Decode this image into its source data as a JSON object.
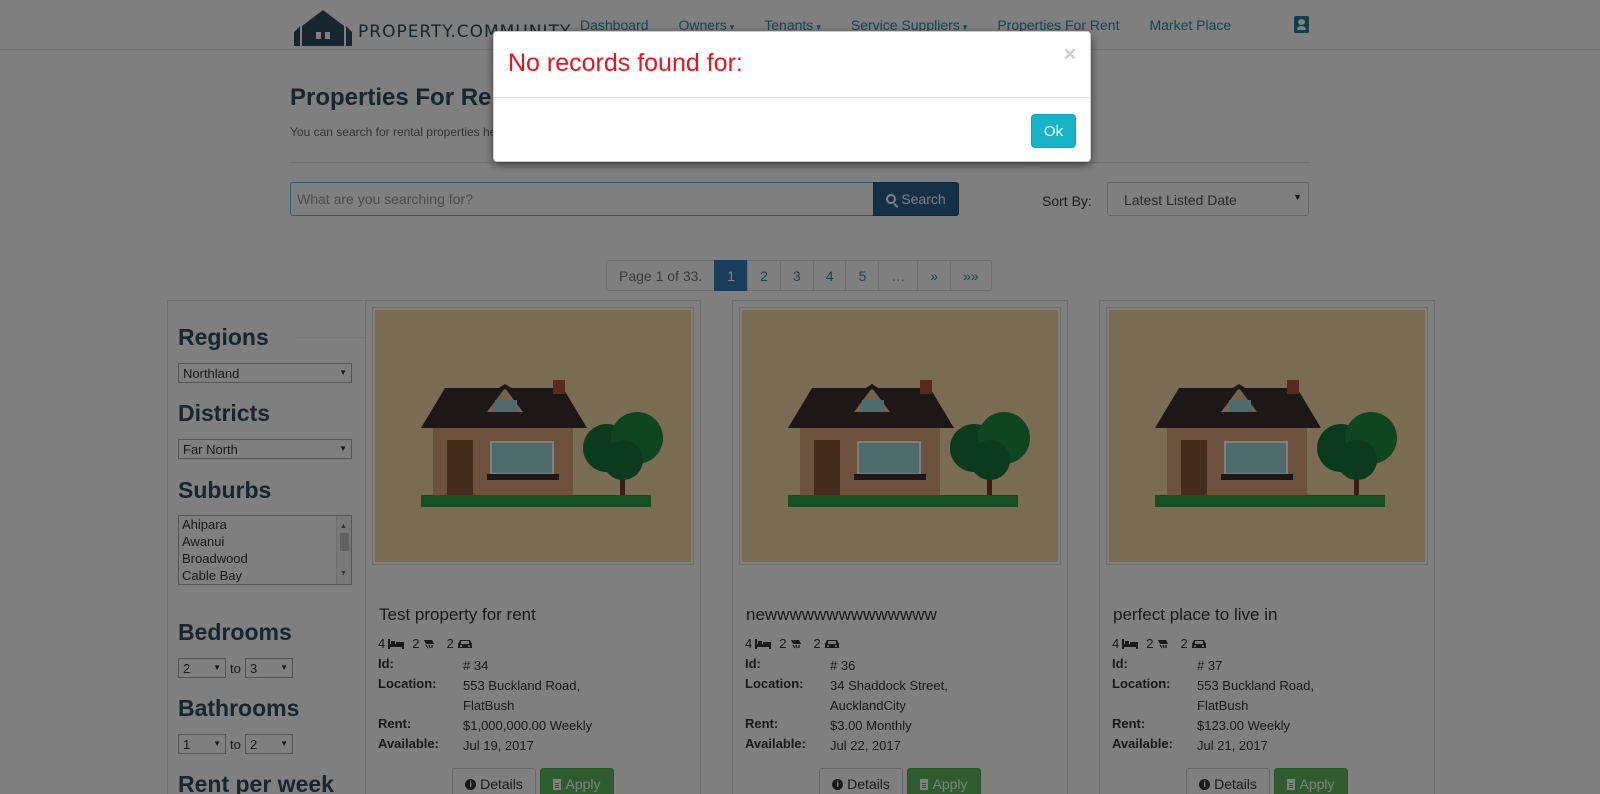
{
  "brand": {
    "logo_text": "PROPERTY.COMMUNITY"
  },
  "nav": {
    "items": [
      {
        "label": "Dashboard",
        "dropdown": false
      },
      {
        "label": "Owners",
        "dropdown": true
      },
      {
        "label": "Tenants",
        "dropdown": true
      },
      {
        "label": "Service Suppliers",
        "dropdown": true
      },
      {
        "label": "Properties For Rent",
        "dropdown": false
      },
      {
        "label": "Market Place",
        "dropdown": false
      }
    ],
    "caret": "▾",
    "profile_icon": "user-card-icon"
  },
  "page": {
    "title": "Properties For Re",
    "subtitle": "You can search for rental properties he"
  },
  "search": {
    "placeholder": "What are you searching for?",
    "button_label": "Search",
    "sort_label": "Sort By:",
    "sort_value": "Latest Listed Date"
  },
  "pagination": {
    "info": "Page 1 of 33.",
    "pages": [
      "1",
      "2",
      "3",
      "4",
      "5"
    ],
    "ellipsis": "…",
    "next": "»",
    "last": "»»"
  },
  "filters": {
    "regions_heading": "Regions",
    "region_value": "Northland",
    "districts_heading": "Districts",
    "district_value": "Far North",
    "suburbs_heading": "Suburbs",
    "suburbs": [
      "Ahipara",
      "Awanui",
      "Broadwood",
      "Cable Bay"
    ],
    "bedrooms_heading": "Bedrooms",
    "bedrooms_from": "2",
    "bedrooms_to": "3",
    "bathrooms_heading": "Bathrooms",
    "bathrooms_from": "1",
    "bathrooms_to": "2",
    "range_separator": "to",
    "rent_heading": "Rent per week"
  },
  "labels": {
    "id": "Id:",
    "location": "Location:",
    "rent": "Rent:",
    "available": "Available:",
    "details": "Details",
    "apply": "Apply"
  },
  "listings": [
    {
      "title": "Test property for rent",
      "beds": "4",
      "baths": "2",
      "cars": "2",
      "id": "# 34",
      "location": "553 Buckland Road, FlatBush",
      "rent": "$1,000,000.00 Weekly",
      "available": "Jul 19, 2017"
    },
    {
      "title": "newwwwwwwwwwwwww",
      "beds": "4",
      "baths": "2",
      "cars": "2",
      "id": "# 36",
      "location": "34 Shaddock Street, AucklandCity",
      "rent": "$3.00 Monthly",
      "available": "Jul 22, 2017"
    },
    {
      "title": "perfect place to live in",
      "beds": "4",
      "baths": "2",
      "cars": "2",
      "id": "# 37",
      "location": "553 Buckland Road, FlatBush",
      "rent": "$123.00 Weekly",
      "available": "Jul 21, 2017"
    }
  ],
  "modal": {
    "title": "No records found for:",
    "close": "×",
    "ok_label": "Ok"
  },
  "colors": {
    "brand": "#2c4a5c",
    "link": "#2a8aa5",
    "primary": "#337ab7",
    "success": "#5cb85c",
    "danger_text": "#e8141f",
    "info_button": "#17b3c7"
  }
}
